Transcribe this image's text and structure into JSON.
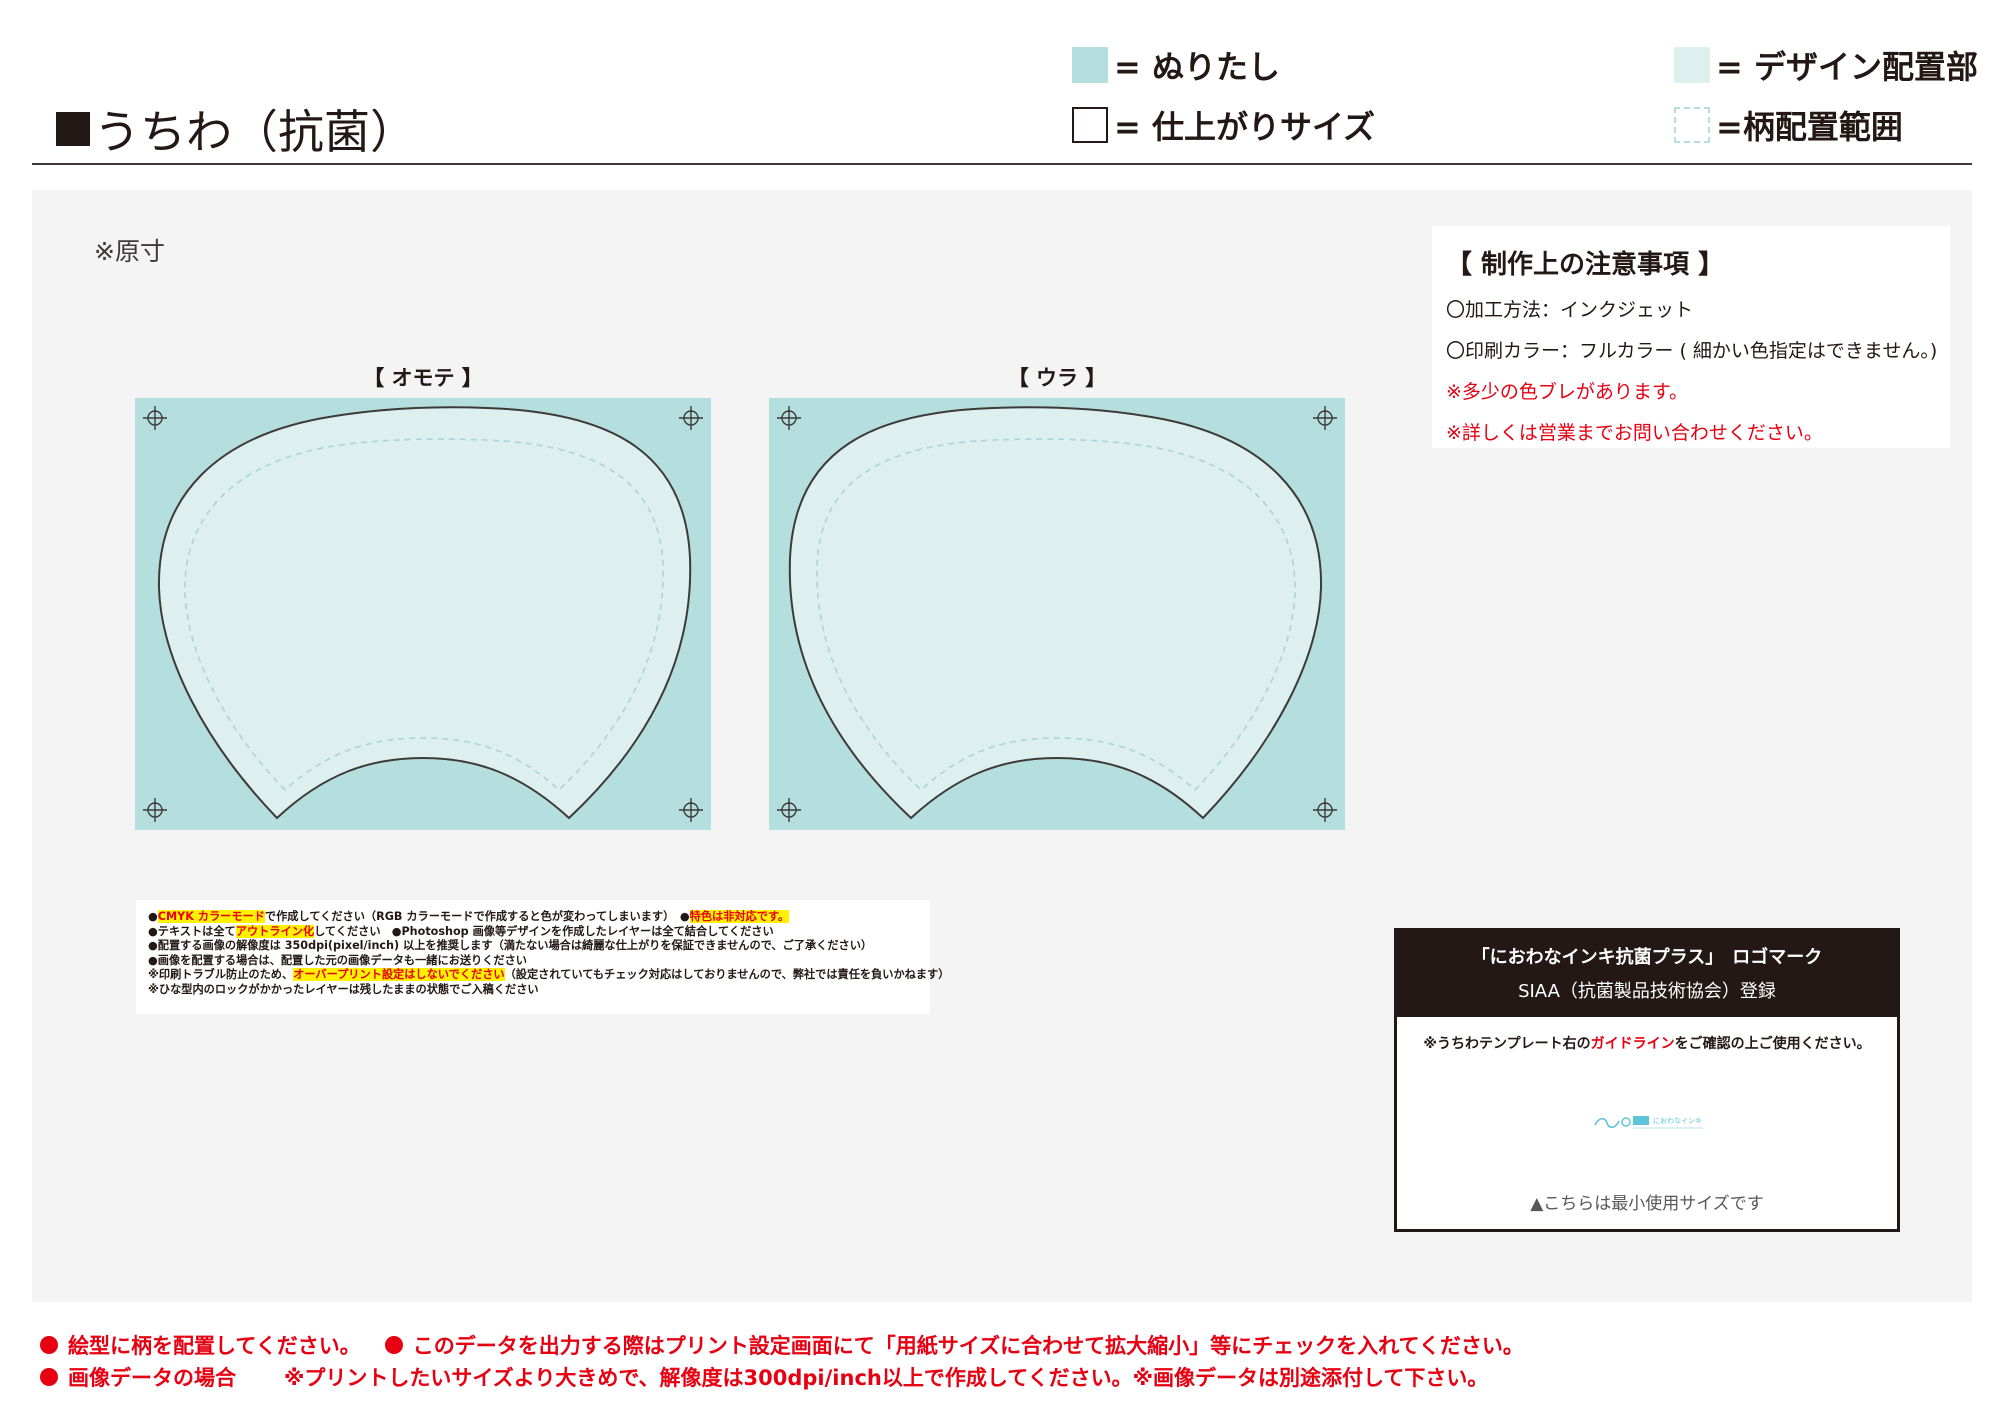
{
  "header": {
    "title": "うちわ（抗菌）",
    "legend": {
      "bleed": "= ぬりたし",
      "trim": "= 仕上がりサイズ",
      "design": "= デザイン配置部",
      "pattern": "=柄配置範囲"
    }
  },
  "canvas": {
    "scale_note": "※原寸",
    "front_label": "【 オモテ 】",
    "back_label": "【 ウラ 】"
  },
  "notes": {
    "heading": "【 制作上の注意事項 】",
    "method": "〇加工方法：インクジェット",
    "color": "〇印刷カラー：フルカラー ( 細かい色指定はできません。)",
    "warn1": "※多少の色ブレがあります。",
    "warn2": "※詳しくは営業までお問い合わせください。"
  },
  "instructions": {
    "l1_pre": "●",
    "l1_hl": "CMYK カラーモード",
    "l1_mid": "で作成してください（RGB カラーモードで作成すると色が変わってしまいます）　●",
    "l1_hl2": "特色は非対応です。",
    "l2_pre": "●テキストは全て",
    "l2_hl": "アウトライン化",
    "l2_post": "してください　●Photoshop 画像等デザインを作成したレイヤーは全て結合してください",
    "l3": "●配置する画像の解像度は 350dpi(pixel/inch) 以上を推奨します（満たない場合は綺麗な仕上がりを保証できませんので、ご了承ください）",
    "l4": "●画像を配置する場合は、配置した元の画像データも一緒にお送りください",
    "l5_pre": "※印刷トラブル防止のため、",
    "l5_hl": "オーバープリント設定はしないでください",
    "l5_post": "（設定されていてもチェック対応はしておりませんので、弊社では責任を負いかねます）",
    "l6": "※ひな型内のロックがかかったレイヤーは残したままの状態でご入稿ください"
  },
  "logo_box": {
    "title": "「におわなインキ抗菌プラス」　ロゴマーク",
    "subtitle": "SIAA（抗菌製品技術協会）登録",
    "guide_pre": "※うちわテンプレート右の",
    "guide_hl": "ガイドライン",
    "guide_post": "をご確認の上ご使用ください。",
    "logo_text": "におわなインキ",
    "min_size": "▲こちらは最小使用サイズです"
  },
  "footer": {
    "line1_a": "絵型に柄を配置してください。",
    "line1_b": "このデータを出力する際はプリント設定画面にて「用紙サイズに合わせて拡大縮小」等にチェックを入れてください。",
    "line2_a": "画像データの場合",
    "line2_b": "※プリントしたいサイズより大きめで、解像度は300dpi/inch以上で作成してください。※画像データは別途添付して下さい。"
  },
  "colors": {
    "bleed": "#b5dfdf",
    "design": "#ddf0ef",
    "accent_red": "#e60012",
    "panel": "#f4f4f4"
  }
}
